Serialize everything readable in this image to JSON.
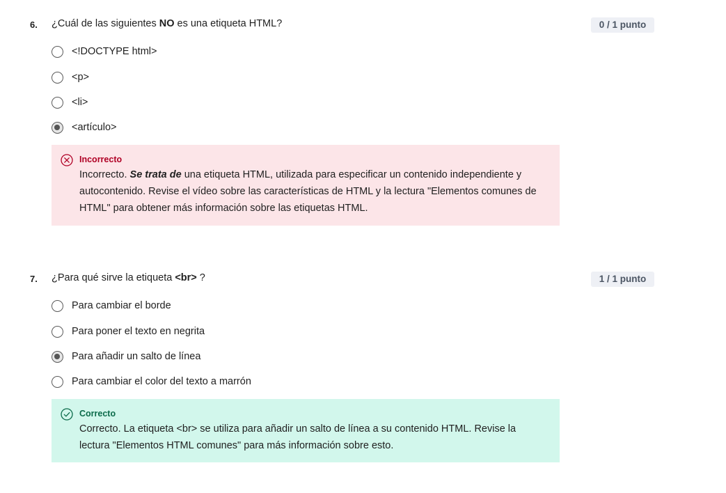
{
  "questions": [
    {
      "number": "6.",
      "text_before": "¿Cuál de las siguientes ",
      "text_bold": "NO",
      "text_after": " es una etiqueta HTML?",
      "points": "0 / 1 punto",
      "options": [
        {
          "label": "<!DOCTYPE html>",
          "selected": false
        },
        {
          "label": "<p>",
          "selected": false
        },
        {
          "label": "<li>",
          "selected": false
        },
        {
          "label": "<artículo>",
          "selected": true
        }
      ],
      "feedback": {
        "status": "Incorrecto",
        "result": "incorrect",
        "text_before": "Incorrecto. ",
        "text_emph": "Se trata de",
        "text_after": " una etiqueta HTML, utilizada para especificar un contenido independiente y autocontenido. Revise el vídeo sobre las características de HTML y la lectura \"Elementos comunes de HTML\" para obtener más información sobre las etiquetas HTML."
      }
    },
    {
      "number": "7.",
      "text_before": "¿Para qué sirve la etiqueta ",
      "text_bold": "<br>",
      "text_after": " ?",
      "points": "1 / 1 punto",
      "options": [
        {
          "label": "Para cambiar el borde",
          "selected": false
        },
        {
          "label": "Para poner el texto en negrita",
          "selected": false
        },
        {
          "label": "Para añadir un salto de línea",
          "selected": true
        },
        {
          "label": "Para cambiar el color del texto a marrón",
          "selected": false
        }
      ],
      "feedback": {
        "status": "Correcto",
        "result": "correct",
        "text_before": "Correcto. La etiqueta <br> se utiliza para añadir un salto de línea a su contenido HTML. Revise la lectura \"Elementos HTML comunes\" para más información sobre esto.",
        "text_emph": "",
        "text_after": ""
      }
    }
  ],
  "colors": {
    "incorrect_bg": "#fce5e8",
    "incorrect_accent": "#b00025",
    "correct_bg": "#d2f7ec",
    "correct_accent": "#0b6b4a"
  },
  "icons": {
    "incorrect": "x-circle-icon",
    "correct": "check-circle-icon"
  }
}
